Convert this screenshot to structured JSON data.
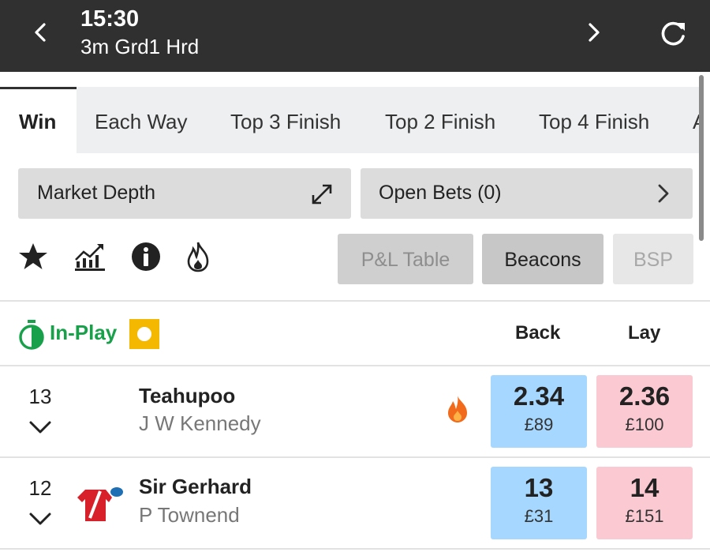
{
  "header": {
    "time": "15:30",
    "race_name": "3m Grd1 Hrd",
    "back_icon": "chevron-left-icon",
    "next_icon": "chevron-right-icon",
    "refresh_icon": "refresh-icon"
  },
  "tabs": [
    {
      "label": "Win",
      "active": true
    },
    {
      "label": "Each Way",
      "active": false
    },
    {
      "label": "Top 3 Finish",
      "active": false
    },
    {
      "label": "Top 2 Finish",
      "active": false
    },
    {
      "label": "Top 4 Finish",
      "active": false
    },
    {
      "label": "Al",
      "active": false
    }
  ],
  "market_depth": {
    "label": "Market Depth",
    "icon": "expand-icon"
  },
  "open_bets": {
    "label": "Open Bets  (0)",
    "icon": "chevron-right-icon"
  },
  "tools": {
    "icons": [
      "star-icon",
      "chart-icon",
      "info-icon",
      "flame-icon"
    ],
    "pl_table": "P&L Table",
    "beacons": "Beacons",
    "bsp": "BSP"
  },
  "market_header": {
    "inplay_label": "In-Play",
    "back_label": "Back",
    "lay_label": "Lay"
  },
  "runners": [
    {
      "number": "13",
      "name": "Teahupoo",
      "jockey": "J W Kennedy",
      "hot": true,
      "back_price": "2.34",
      "back_amount": "£89",
      "lay_price": "2.36",
      "lay_amount": "£100"
    },
    {
      "number": "12",
      "name": "Sir Gerhard",
      "jockey": "P Townend",
      "hot": false,
      "back_price": "13",
      "back_amount": "£31",
      "lay_price": "14",
      "lay_amount": "£151"
    }
  ],
  "colors": {
    "header_bg": "#303030",
    "back": "#a6d8ff",
    "lay": "#fac9d1",
    "inplay": "#18a04a",
    "inplay_badge": "#f5b800",
    "flame": "#f26a1b",
    "silks_red": "#d8202a",
    "silks_cap": "#1f6fb5"
  }
}
